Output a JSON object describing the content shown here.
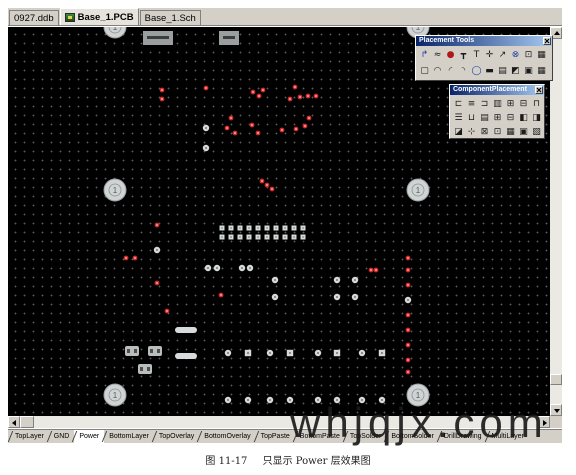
{
  "tabs": [
    {
      "label": "0927.ddb"
    },
    {
      "label": "Base_1.PCB",
      "icon": "pcb-document-icon",
      "active": true
    },
    {
      "label": "Base_1.Sch"
    }
  ],
  "placement_tools": {
    "title": "Placement Tools",
    "icons": [
      "interactive-routing-icon",
      "place-line-icon",
      "place-pad-icon",
      "place-via-icon",
      "place-string-icon",
      "place-coordinate-icon",
      "place-dimension-icon",
      "set-origin-icon",
      "place-room-icon",
      "place-room-fill-icon",
      "place-component-icon",
      "arc-center-icon",
      "arc-edge-icon",
      "arc-any-angle-icon",
      "full-circle-icon",
      "place-fill-icon",
      "polygon-plane-icon",
      "split-plane-icon",
      "place-keepout-icon",
      "array-paste-icon"
    ]
  },
  "component_placement": {
    "title": "ComponentPlacement",
    "icons": [
      "align-left-icon",
      "align-horizontal-center-icon",
      "align-right-icon",
      "horizontal-spacing-equal-icon",
      "horizontal-spacing-increase-icon",
      "horizontal-spacing-decrease-icon",
      "align-top-icon",
      "align-vertical-center-icon",
      "align-bottom-icon",
      "vertical-spacing-equal-icon",
      "vertical-spacing-increase-icon",
      "vertical-spacing-decrease-icon",
      "arrange-within-room-icon",
      "arrange-within-rectangle-icon",
      "arrange-outside-board-icon",
      "move-to-grid-icon",
      "create-union-icon",
      "break-union-icon",
      "align-to-grid-icon",
      "move-component-icon",
      "component-properties-icon"
    ]
  },
  "mounting_hole_label": "1",
  "layers": [
    {
      "label": "TopLayer"
    },
    {
      "label": "GND"
    },
    {
      "label": "Power",
      "active": true
    },
    {
      "label": "BottomLayer"
    },
    {
      "label": "TopOverlay"
    },
    {
      "label": "BottomOverlay"
    },
    {
      "label": "TopPaste"
    },
    {
      "label": "BottomPaste"
    },
    {
      "label": "TopSolder"
    },
    {
      "label": "BottomSolder"
    },
    {
      "label": "DrillDrawing"
    },
    {
      "label": "MultiLayer"
    }
  ],
  "watermark": "whjqjx.com",
  "caption": {
    "figure": "图 11-17",
    "text": "只显示 Power 层效果图"
  },
  "colors": {
    "canvas": "#000000",
    "power_via": "#d42a2a",
    "pad": "#d6dada",
    "mounting_hole": "#cfd3d3",
    "title_bar": "#0a246a"
  }
}
